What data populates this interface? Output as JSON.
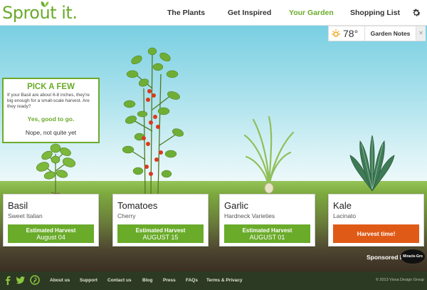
{
  "header": {
    "logo_text": "Sprout it.",
    "nav": [
      "The Plants",
      "Get Inspired",
      "Your Garden",
      "Shopping List"
    ],
    "active_nav": "Your Garden"
  },
  "weather": {
    "temperature": "78°",
    "notes_label": "Garden Notes",
    "icon": "sun-icon"
  },
  "prompt": {
    "title": "PICK A FEW",
    "body": "If your Basil are about 6-8 inches, they're big enough for a small-scale harvest. Are they ready?",
    "yes_label": "Yes, good to go.",
    "no_label": "Nope, not quite yet"
  },
  "plants": [
    {
      "name": "Basil",
      "variety": "Sweet Italian",
      "button_label": "Estimated Harvest",
      "button_date": "August 04"
    },
    {
      "name": "Tomatoes",
      "variety": "Cherry",
      "button_label": "Estimated Harvest",
      "button_date": "AUGUST 15"
    },
    {
      "name": "Garlic",
      "variety": "Hardneck Varieties",
      "button_label": "Estimated Harvest",
      "button_date": "AUGUST 01"
    },
    {
      "name": "Kale",
      "variety": "Lacinato",
      "button_label": "Harvest time!"
    }
  ],
  "sponsor": {
    "label": "Sponsored by",
    "logo_text": "Miracle-Gro"
  },
  "footer": {
    "links": [
      "About us",
      "Support",
      "Contact us",
      "Blog",
      "Press",
      "FAQs",
      "Terms & Privacy"
    ],
    "copyright": "© 2013 Vixxa Design Group",
    "social_icons": [
      "facebook-icon",
      "twitter-icon",
      "pinterest-icon"
    ]
  },
  "colors": {
    "brand_green": "#6aab2a",
    "harvest_orange": "#e05a17",
    "footer": "#2d3a23"
  }
}
